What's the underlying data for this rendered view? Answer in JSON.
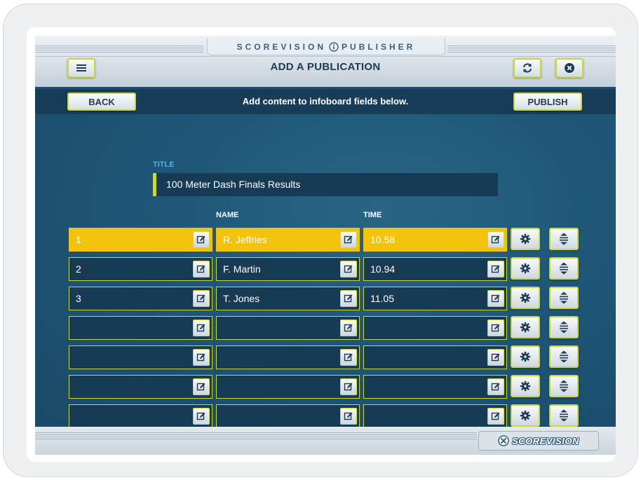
{
  "header": {
    "brand_left": "SCOREVISION",
    "brand_right": "PUBLISHER",
    "page_title": "ADD A PUBLICATION",
    "menu_icon": "hamburger-icon",
    "refresh_icon": "refresh-icon",
    "close_icon": "close-icon"
  },
  "actionbar": {
    "back_label": "BACK",
    "instructions": "Add content to infoboard fields below.",
    "publish_label": "PUBLISH"
  },
  "form": {
    "title_label": "TITLE",
    "title_value": "100 Meter Dash Finals Results",
    "columns": [
      "",
      "NAME",
      "TIME"
    ],
    "rows": [
      {
        "place": "1",
        "name": "R. Jeffries",
        "time": "10.58",
        "highlighted": true
      },
      {
        "place": "2",
        "name": "F. Martin",
        "time": "10.94",
        "highlighted": false
      },
      {
        "place": "3",
        "name": "T. Jones",
        "time": "11.05",
        "highlighted": false
      },
      {
        "place": "",
        "name": "",
        "time": "",
        "highlighted": false
      },
      {
        "place": "",
        "name": "",
        "time": "",
        "highlighted": false
      },
      {
        "place": "",
        "name": "",
        "time": "",
        "highlighted": false
      },
      {
        "place": "",
        "name": "",
        "time": "",
        "highlighted": false
      },
      {
        "place": "",
        "name": "",
        "time": "",
        "highlighted": false
      }
    ]
  },
  "footer": {
    "logo_text": "SCOREVISION"
  },
  "colors": {
    "accent": "#c9d83a",
    "highlight": "#f2c20d",
    "panel": "#173a55",
    "background": "#1f5677"
  }
}
